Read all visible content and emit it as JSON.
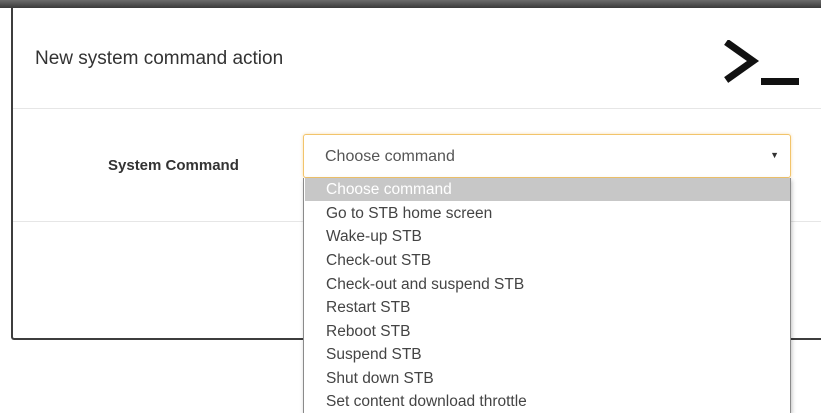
{
  "dialog": {
    "title": "New system command action",
    "header_icon": "terminal-prompt-icon"
  },
  "form": {
    "system_command": {
      "label": "System Command",
      "value": "Choose command",
      "caret": "▼"
    }
  },
  "dropdown": {
    "highlighted_option": "Choose command",
    "options": [
      "Choose command",
      "Go to STB home screen",
      "Wake-up STB",
      "Check-out STB",
      "Check-out and suspend STB",
      "Restart STB",
      "Reboot STB",
      "Suspend STB",
      "Shut down STB",
      "Set content download throttle"
    ]
  },
  "colors": {
    "focus_border": "#f2c46b",
    "highlight": "#c7c7c7",
    "text": "#333333"
  }
}
